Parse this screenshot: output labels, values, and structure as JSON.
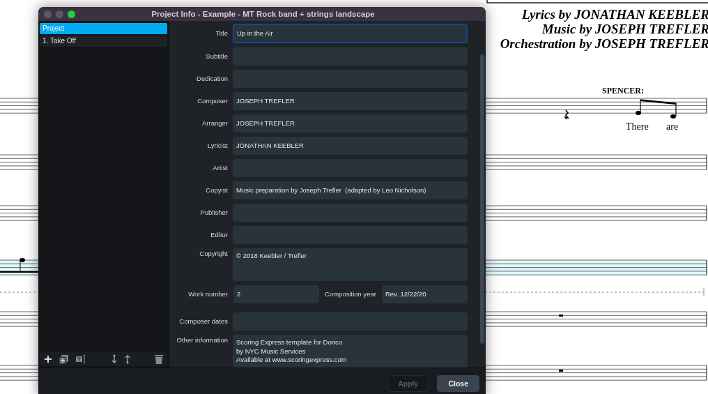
{
  "score": {
    "credits": [
      "Lyrics by JONATHAN KEEBLER",
      "Music by JOSEPH TREFLER",
      "Orchestration by JOSEPH TREFLER"
    ],
    "character": "SPENCER:",
    "lyrics": [
      "There",
      "are"
    ]
  },
  "window": {
    "title": "Project Info - Example - MT Rock band + strings landscape"
  },
  "sidebar": {
    "items": [
      {
        "label": "Project",
        "selected": true
      },
      {
        "label": "1. Take Off",
        "selected": false
      }
    ]
  },
  "fields": [
    {
      "kind": "line",
      "label": "Title",
      "value": "Up in the Air",
      "focused": true
    },
    {
      "kind": "line",
      "label": "Subtitle",
      "focused": false
    },
    {
      "kind": "line",
      "label": "Dedication",
      "focused": false
    },
    {
      "kind": "line",
      "label": "Composer",
      "value": "JOSEPH TREFLER",
      "focused": false
    },
    {
      "kind": "line",
      "label": "Arranger",
      "value": "JOSEPH TREFLER",
      "focused": false
    },
    {
      "kind": "line",
      "label": "Lyricist",
      "value": "JONATHAN KEEBLER",
      "focused": false
    },
    {
      "kind": "line",
      "label": "Artist",
      "focused": false
    },
    {
      "kind": "line",
      "label": "Copyist",
      "value": "Music preparation by Joseph Trefler  (adapted by Leo Nicholson)",
      "focused": false
    },
    {
      "kind": "line",
      "label": "Publisher",
      "focused": false
    },
    {
      "kind": "line",
      "label": "Editor",
      "focused": false
    },
    {
      "kind": "area",
      "label": "Copyright",
      "value": "© 2018 Keebler / Trefler",
      "focused": false
    },
    {
      "kind": "pair",
      "label": "Work number",
      "value": "2",
      "label2": "Composition year",
      "value2": "Rev. 12/22/20",
      "focused": false
    },
    {
      "kind": "line",
      "label": "Composer dates",
      "focused": false
    },
    {
      "kind": "area",
      "label": "Other information",
      "value": "Scoring Express template for Dorico\nby NYC Music Services\nAvailable at www.scoringexpress.com",
      "focused": false
    }
  ],
  "buttons": [
    {
      "label": "Apply",
      "disabled": true
    },
    {
      "label": "Close",
      "disabled": false
    }
  ]
}
